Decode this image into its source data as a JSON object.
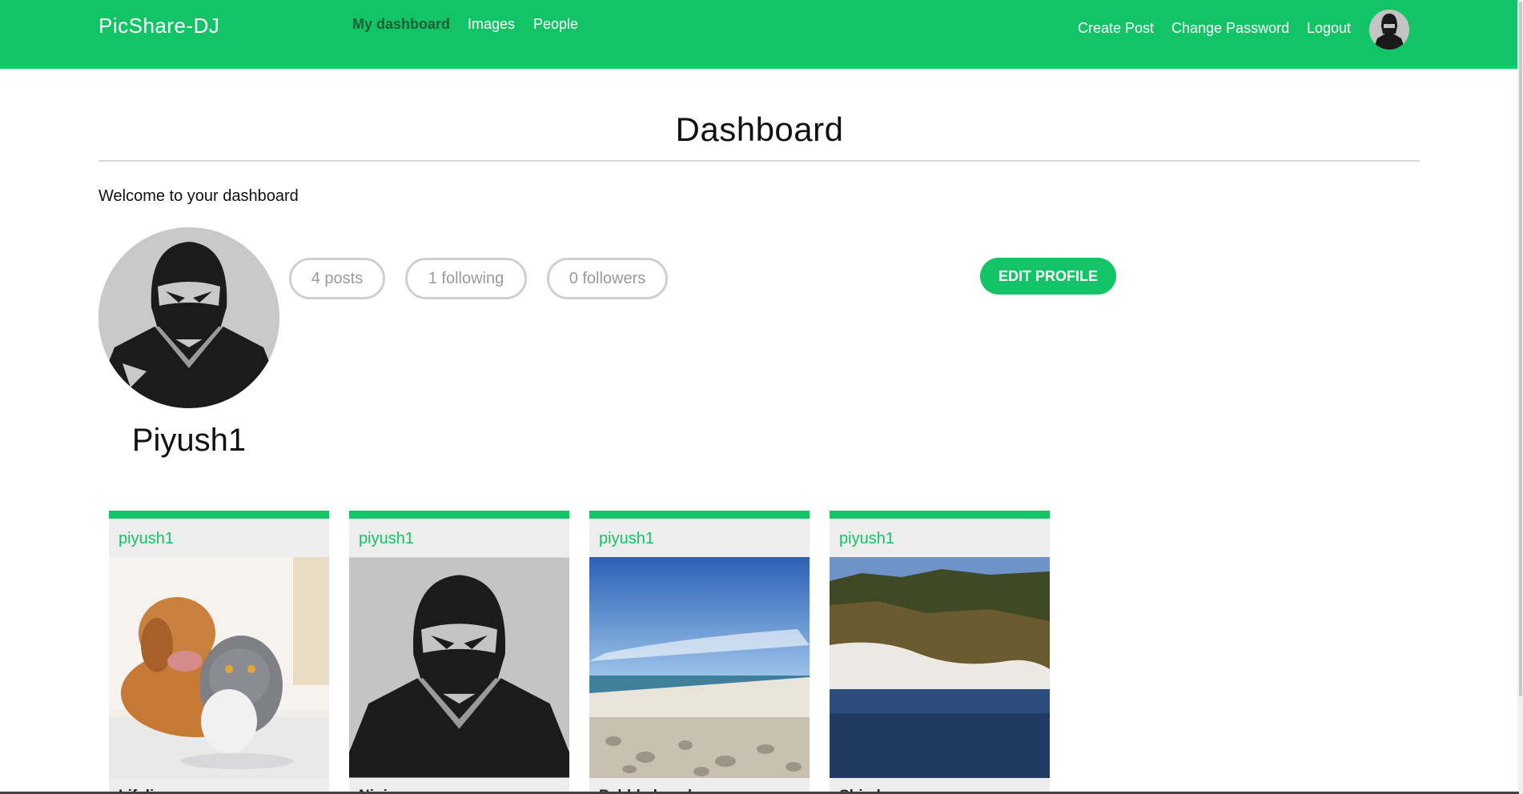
{
  "nav": {
    "brand": "PicShare-DJ",
    "links": [
      "My dashboard",
      "Images",
      "People"
    ],
    "right_links": [
      "Create Post",
      "Change Password",
      "Logout"
    ]
  },
  "page": {
    "title": "Dashboard",
    "welcome": "Welcome to your dashboard"
  },
  "profile": {
    "username": "Piyush1",
    "posts": "4 posts",
    "following": "1 following",
    "followers": "0 followers",
    "edit_label": "EDIT PROFILE"
  },
  "posts": [
    {
      "user": "piyush1",
      "caption": "Lifeline",
      "image": "dog-and-cat-photo"
    },
    {
      "user": "piyush1",
      "caption": "Ninja",
      "image": "ninja-photo"
    },
    {
      "user": "piyush1",
      "caption": "Pebble beach",
      "image": "beach-photo"
    },
    {
      "user": "piyush1",
      "caption": "Shimla",
      "image": "snowy-forest-photo"
    }
  ],
  "colors": {
    "accent": "#12c466",
    "card_bg": "#ededed"
  }
}
